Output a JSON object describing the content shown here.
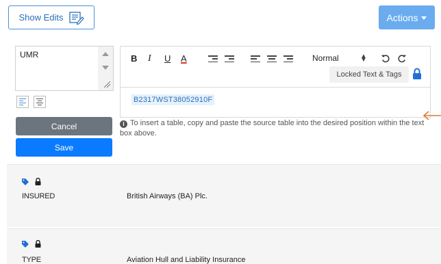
{
  "header": {
    "show_edits_label": "Show Edits",
    "actions_label": "Actions"
  },
  "editor_sidebar": {
    "field_value": "UMR",
    "cancel_label": "Cancel",
    "save_label": "Save"
  },
  "toolbar": {
    "bold": "B",
    "italic": "I",
    "underline": "U",
    "font_color": "A",
    "style_value": "Normal",
    "locked_text_label": "Locked Text & Tags"
  },
  "editor": {
    "content": "B2317WST38052910F"
  },
  "hint": {
    "text": "To insert a table, copy and paste the source table into the desired position within the text box above."
  },
  "records": [
    {
      "label": "INSURED",
      "value": "British Airways (BA) Plc."
    },
    {
      "label": "TYPE",
      "value": "Aviation Hull and Liability Insurance"
    }
  ],
  "colors": {
    "primary": "#0a7bff",
    "actions_bg": "#6aacef",
    "cancel_bg": "#6c757d",
    "annotation_arrow": "#e07a2e"
  }
}
